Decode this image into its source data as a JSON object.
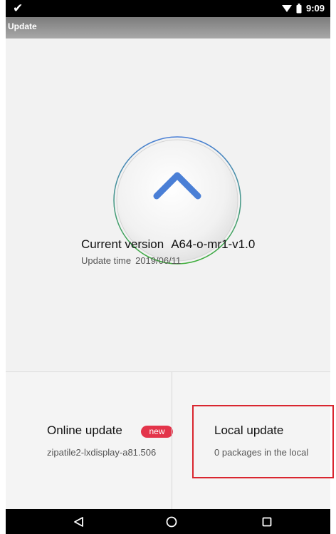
{
  "status_bar": {
    "time": "9:09",
    "icons": [
      "check-icon",
      "wifi-icon",
      "battery-icon"
    ]
  },
  "title_bar": {
    "title": "Update"
  },
  "main": {
    "update_button_icon": "arrow-up-icon",
    "current_version_label": "Current version",
    "current_version_value": "A64-o-mr1-v1.0",
    "update_time_label": "Update time",
    "update_time_value": "2019/06/11"
  },
  "online_update": {
    "title": "Online update",
    "badge": "new",
    "subtitle": "zipatile2-lxdisplay-a81.506"
  },
  "local_update": {
    "title": "Local update",
    "subtitle": "0 packages in the local"
  },
  "nav_bar": {
    "icons": [
      "back-icon",
      "home-icon",
      "recents-icon"
    ]
  },
  "colors": {
    "badge": "#e3344a",
    "highlight": "#d9262f",
    "arrow_top": "#4a7fd6",
    "arrow_bottom": "#3fae3a"
  }
}
